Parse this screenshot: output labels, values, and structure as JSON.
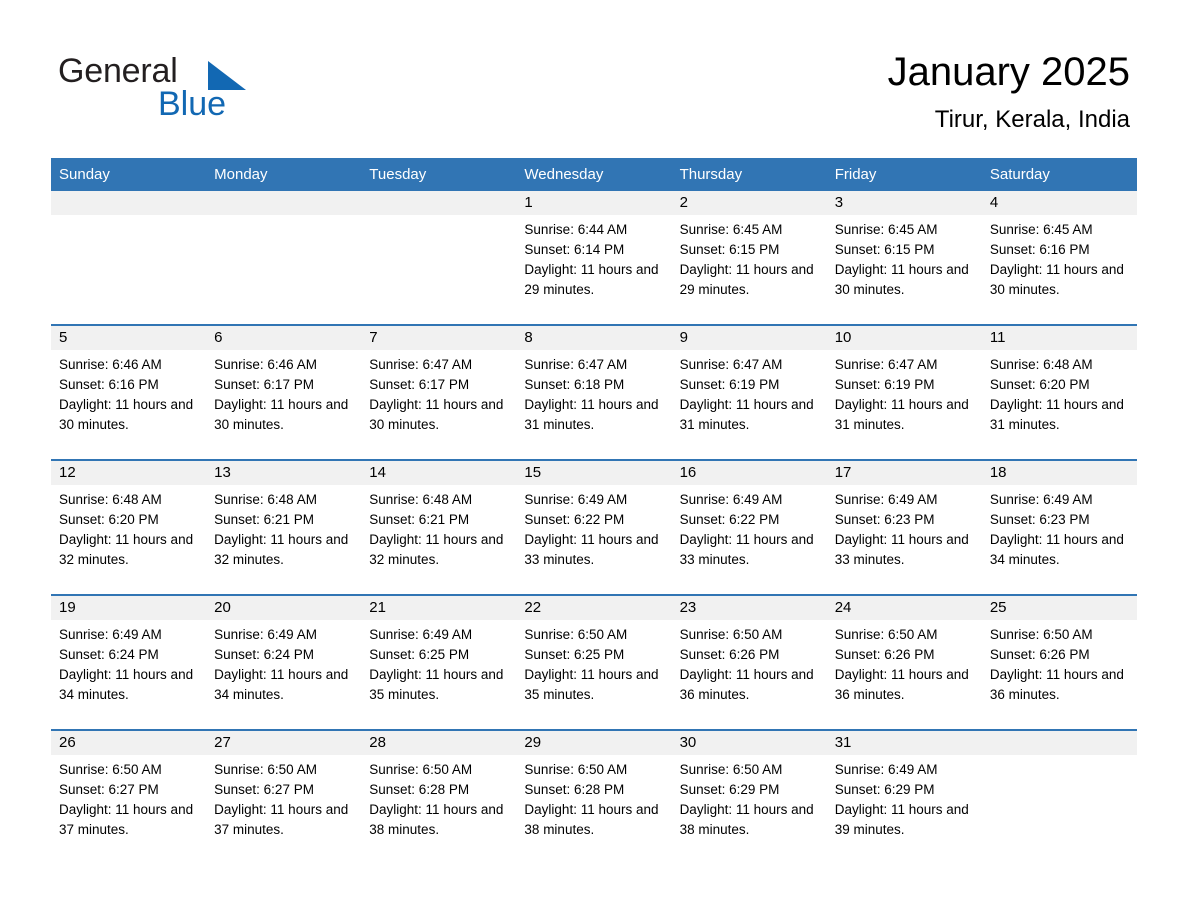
{
  "brand": {
    "name_part1": "General",
    "name_part2": "Blue",
    "triangle_color": "#1268b3"
  },
  "header": {
    "title": "January 2025",
    "location": "Tirur, Kerala, India"
  },
  "theme": {
    "header_blue": "#3175b4",
    "daynum_band": "#f1f1f1",
    "text": "#000000"
  },
  "weekday_headers": [
    "Sunday",
    "Monday",
    "Tuesday",
    "Wednesday",
    "Thursday",
    "Friday",
    "Saturday"
  ],
  "weeks": [
    [
      {
        "day": "",
        "sunrise": "",
        "sunset": "",
        "daylight": ""
      },
      {
        "day": "",
        "sunrise": "",
        "sunset": "",
        "daylight": ""
      },
      {
        "day": "",
        "sunrise": "",
        "sunset": "",
        "daylight": ""
      },
      {
        "day": "1",
        "sunrise": "Sunrise: 6:44 AM",
        "sunset": "Sunset: 6:14 PM",
        "daylight": "Daylight: 11 hours and 29 minutes."
      },
      {
        "day": "2",
        "sunrise": "Sunrise: 6:45 AM",
        "sunset": "Sunset: 6:15 PM",
        "daylight": "Daylight: 11 hours and 29 minutes."
      },
      {
        "day": "3",
        "sunrise": "Sunrise: 6:45 AM",
        "sunset": "Sunset: 6:15 PM",
        "daylight": "Daylight: 11 hours and 30 minutes."
      },
      {
        "day": "4",
        "sunrise": "Sunrise: 6:45 AM",
        "sunset": "Sunset: 6:16 PM",
        "daylight": "Daylight: 11 hours and 30 minutes."
      }
    ],
    [
      {
        "day": "5",
        "sunrise": "Sunrise: 6:46 AM",
        "sunset": "Sunset: 6:16 PM",
        "daylight": "Daylight: 11 hours and 30 minutes."
      },
      {
        "day": "6",
        "sunrise": "Sunrise: 6:46 AM",
        "sunset": "Sunset: 6:17 PM",
        "daylight": "Daylight: 11 hours and 30 minutes."
      },
      {
        "day": "7",
        "sunrise": "Sunrise: 6:47 AM",
        "sunset": "Sunset: 6:17 PM",
        "daylight": "Daylight: 11 hours and 30 minutes."
      },
      {
        "day": "8",
        "sunrise": "Sunrise: 6:47 AM",
        "sunset": "Sunset: 6:18 PM",
        "daylight": "Daylight: 11 hours and 31 minutes."
      },
      {
        "day": "9",
        "sunrise": "Sunrise: 6:47 AM",
        "sunset": "Sunset: 6:19 PM",
        "daylight": "Daylight: 11 hours and 31 minutes."
      },
      {
        "day": "10",
        "sunrise": "Sunrise: 6:47 AM",
        "sunset": "Sunset: 6:19 PM",
        "daylight": "Daylight: 11 hours and 31 minutes."
      },
      {
        "day": "11",
        "sunrise": "Sunrise: 6:48 AM",
        "sunset": "Sunset: 6:20 PM",
        "daylight": "Daylight: 11 hours and 31 minutes."
      }
    ],
    [
      {
        "day": "12",
        "sunrise": "Sunrise: 6:48 AM",
        "sunset": "Sunset: 6:20 PM",
        "daylight": "Daylight: 11 hours and 32 minutes."
      },
      {
        "day": "13",
        "sunrise": "Sunrise: 6:48 AM",
        "sunset": "Sunset: 6:21 PM",
        "daylight": "Daylight: 11 hours and 32 minutes."
      },
      {
        "day": "14",
        "sunrise": "Sunrise: 6:48 AM",
        "sunset": "Sunset: 6:21 PM",
        "daylight": "Daylight: 11 hours and 32 minutes."
      },
      {
        "day": "15",
        "sunrise": "Sunrise: 6:49 AM",
        "sunset": "Sunset: 6:22 PM",
        "daylight": "Daylight: 11 hours and 33 minutes."
      },
      {
        "day": "16",
        "sunrise": "Sunrise: 6:49 AM",
        "sunset": "Sunset: 6:22 PM",
        "daylight": "Daylight: 11 hours and 33 minutes."
      },
      {
        "day": "17",
        "sunrise": "Sunrise: 6:49 AM",
        "sunset": "Sunset: 6:23 PM",
        "daylight": "Daylight: 11 hours and 33 minutes."
      },
      {
        "day": "18",
        "sunrise": "Sunrise: 6:49 AM",
        "sunset": "Sunset: 6:23 PM",
        "daylight": "Daylight: 11 hours and 34 minutes."
      }
    ],
    [
      {
        "day": "19",
        "sunrise": "Sunrise: 6:49 AM",
        "sunset": "Sunset: 6:24 PM",
        "daylight": "Daylight: 11 hours and 34 minutes."
      },
      {
        "day": "20",
        "sunrise": "Sunrise: 6:49 AM",
        "sunset": "Sunset: 6:24 PM",
        "daylight": "Daylight: 11 hours and 34 minutes."
      },
      {
        "day": "21",
        "sunrise": "Sunrise: 6:49 AM",
        "sunset": "Sunset: 6:25 PM",
        "daylight": "Daylight: 11 hours and 35 minutes."
      },
      {
        "day": "22",
        "sunrise": "Sunrise: 6:50 AM",
        "sunset": "Sunset: 6:25 PM",
        "daylight": "Daylight: 11 hours and 35 minutes."
      },
      {
        "day": "23",
        "sunrise": "Sunrise: 6:50 AM",
        "sunset": "Sunset: 6:26 PM",
        "daylight": "Daylight: 11 hours and 36 minutes."
      },
      {
        "day": "24",
        "sunrise": "Sunrise: 6:50 AM",
        "sunset": "Sunset: 6:26 PM",
        "daylight": "Daylight: 11 hours and 36 minutes."
      },
      {
        "day": "25",
        "sunrise": "Sunrise: 6:50 AM",
        "sunset": "Sunset: 6:26 PM",
        "daylight": "Daylight: 11 hours and 36 minutes."
      }
    ],
    [
      {
        "day": "26",
        "sunrise": "Sunrise: 6:50 AM",
        "sunset": "Sunset: 6:27 PM",
        "daylight": "Daylight: 11 hours and 37 minutes."
      },
      {
        "day": "27",
        "sunrise": "Sunrise: 6:50 AM",
        "sunset": "Sunset: 6:27 PM",
        "daylight": "Daylight: 11 hours and 37 minutes."
      },
      {
        "day": "28",
        "sunrise": "Sunrise: 6:50 AM",
        "sunset": "Sunset: 6:28 PM",
        "daylight": "Daylight: 11 hours and 38 minutes."
      },
      {
        "day": "29",
        "sunrise": "Sunrise: 6:50 AM",
        "sunset": "Sunset: 6:28 PM",
        "daylight": "Daylight: 11 hours and 38 minutes."
      },
      {
        "day": "30",
        "sunrise": "Sunrise: 6:50 AM",
        "sunset": "Sunset: 6:29 PM",
        "daylight": "Daylight: 11 hours and 38 minutes."
      },
      {
        "day": "31",
        "sunrise": "Sunrise: 6:49 AM",
        "sunset": "Sunset: 6:29 PM",
        "daylight": "Daylight: 11 hours and 39 minutes."
      },
      {
        "day": "",
        "sunrise": "",
        "sunset": "",
        "daylight": ""
      }
    ]
  ]
}
